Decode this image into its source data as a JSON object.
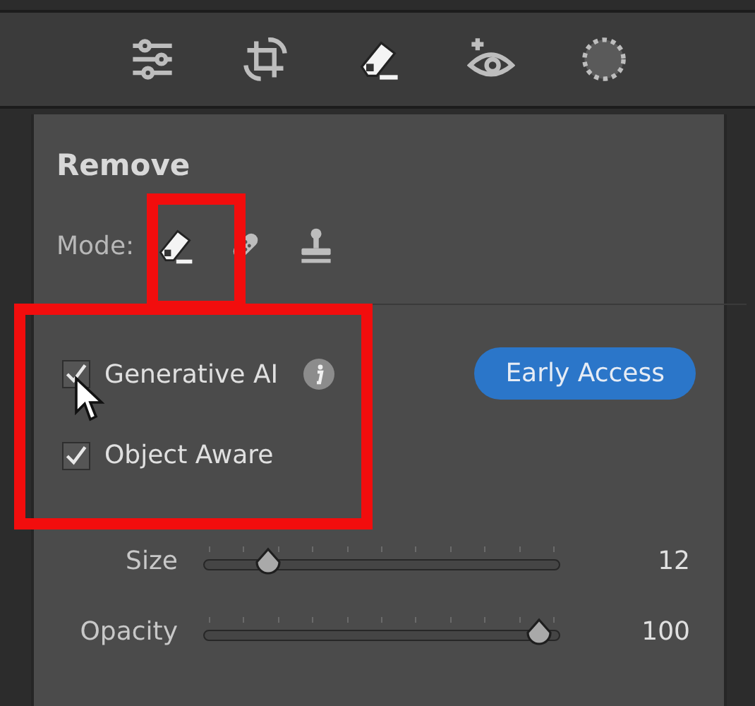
{
  "toolbar": {
    "tools": [
      {
        "kind": "sliders",
        "selected": false
      },
      {
        "kind": "crop",
        "selected": false
      },
      {
        "kind": "eraser",
        "selected": true
      },
      {
        "kind": "eye",
        "selected": false
      },
      {
        "kind": "mask",
        "selected": false
      }
    ]
  },
  "panel": {
    "title": "Remove",
    "mode": {
      "label": "Mode:",
      "options": [
        {
          "kind": "eraser",
          "selected": true
        },
        {
          "kind": "bandage",
          "selected": false
        },
        {
          "kind": "stamp",
          "selected": false
        }
      ]
    },
    "options": [
      {
        "label": "Generative AI",
        "checked": true,
        "info": true
      },
      {
        "label": "Object Aware",
        "checked": true,
        "info": false
      }
    ],
    "badge": "Early Access",
    "sliders": [
      {
        "label": "Size",
        "level": 0.14,
        "reading": "12"
      },
      {
        "label": "Opacity",
        "level": 1,
        "reading": "100"
      }
    ]
  }
}
